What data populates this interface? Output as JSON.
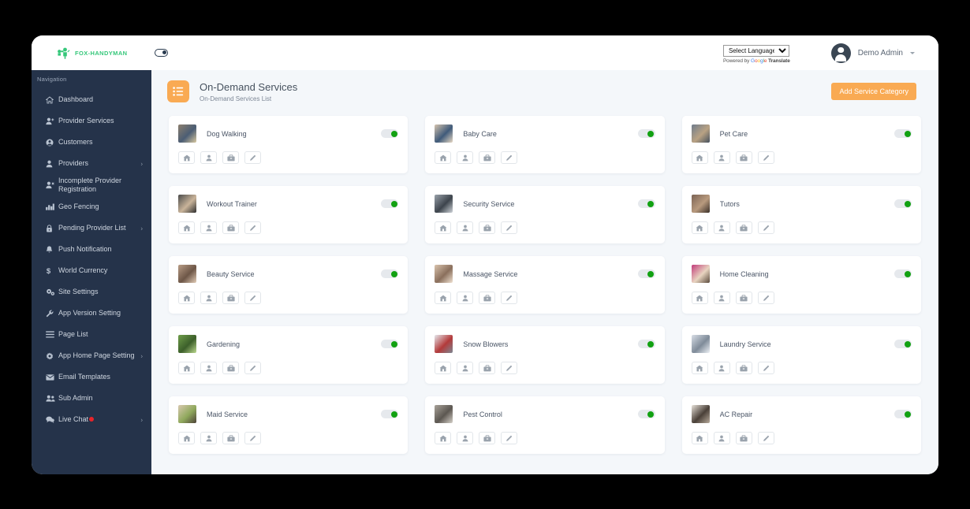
{
  "brand": {
    "name": "FOX-HANDYMAN",
    "logo_color": "#35c77a"
  },
  "topbar": {
    "language_selected": "Select Language",
    "language_options": [
      "Select Language"
    ],
    "powered_by": "Powered by",
    "google": "Google",
    "translate": "Translate",
    "user_name": "Demo Admin"
  },
  "sidebar": {
    "caption": "Navigation",
    "items": [
      {
        "label": "Dashboard",
        "icon": "home-icon",
        "chevron": false,
        "badge": false
      },
      {
        "label": "Provider Services",
        "icon": "user-plus-icon",
        "chevron": false,
        "badge": false
      },
      {
        "label": "Customers",
        "icon": "user-circle-icon",
        "chevron": false,
        "badge": false
      },
      {
        "label": "Providers",
        "icon": "user-icon",
        "chevron": true,
        "badge": false
      },
      {
        "label": "Incomplete Provider Registration",
        "icon": "user-times-icon",
        "chevron": false,
        "badge": false
      },
      {
        "label": "Geo Fencing",
        "icon": "map-icon",
        "chevron": false,
        "badge": false
      },
      {
        "label": "Pending Provider List",
        "icon": "lock-icon",
        "chevron": true,
        "badge": false
      },
      {
        "label": "Push Notification",
        "icon": "bell-icon",
        "chevron": false,
        "badge": false
      },
      {
        "label": "World Currency",
        "icon": "dollar-icon",
        "chevron": false,
        "badge": false
      },
      {
        "label": "Site Settings",
        "icon": "cogs-icon",
        "chevron": false,
        "badge": false
      },
      {
        "label": "App Version Setting",
        "icon": "wrench-icon",
        "chevron": false,
        "badge": false
      },
      {
        "label": "Page List",
        "icon": "list-icon",
        "chevron": false,
        "badge": false
      },
      {
        "label": "App Home Page Setting",
        "icon": "gear-icon",
        "chevron": true,
        "badge": false
      },
      {
        "label": "Email Templates",
        "icon": "envelope-icon",
        "chevron": false,
        "badge": false
      },
      {
        "label": "Sub Admin",
        "icon": "users-icon",
        "chevron": false,
        "badge": false
      },
      {
        "label": "Live Chat",
        "icon": "chat-icon",
        "chevron": true,
        "badge": true
      }
    ]
  },
  "page": {
    "title": "On-Demand Services",
    "subtitle": "On-Demand Services List",
    "icon": "list-icon",
    "add_button": "Add Service Category",
    "accent_color": "#f9aa53"
  },
  "card_actions": [
    {
      "name": "home-icon",
      "title": "Home"
    },
    {
      "name": "provider-icon",
      "title": "Provider"
    },
    {
      "name": "briefcase-icon",
      "title": "Services"
    },
    {
      "name": "edit-icon",
      "title": "Edit"
    }
  ],
  "services": [
    {
      "title": "Dog Walking",
      "enabled": true,
      "thumb": [
        "#8c7f6e",
        "#4b5d74",
        "#d9c9a0"
      ]
    },
    {
      "title": "Baby Care",
      "enabled": true,
      "thumb": [
        "#d6c4ae",
        "#3f5a7a",
        "#e8d9c4"
      ]
    },
    {
      "title": "Pet Care",
      "enabled": true,
      "thumb": [
        "#6f7c8c",
        "#b9a283",
        "#45505e"
      ]
    },
    {
      "title": "Workout Trainer",
      "enabled": true,
      "thumb": [
        "#4a4a4a",
        "#c9b49a",
        "#2e2e2e"
      ]
    },
    {
      "title": "Security Service",
      "enabled": true,
      "thumb": [
        "#9aa2ab",
        "#3d444c",
        "#cfd4d9"
      ]
    },
    {
      "title": "Tutors",
      "enabled": true,
      "thumb": [
        "#7a6253",
        "#b89a7e",
        "#3a2f28"
      ]
    },
    {
      "title": "Beauty Service",
      "enabled": true,
      "thumb": [
        "#b99d86",
        "#6d5647",
        "#e3cdb8"
      ]
    },
    {
      "title": "Massage Service",
      "enabled": true,
      "thumb": [
        "#d9c3ad",
        "#8a6f5c",
        "#f0e2d2"
      ]
    },
    {
      "title": "Home Cleaning",
      "enabled": true,
      "thumb": [
        "#c23b7a",
        "#e8d4c0",
        "#5a4a3c"
      ]
    },
    {
      "title": "Gardening",
      "enabled": true,
      "thumb": [
        "#6f9e4a",
        "#3c5f2a",
        "#bcd98f"
      ]
    },
    {
      "title": "Snow Blowers",
      "enabled": true,
      "thumb": [
        "#e5e9ee",
        "#b33a3a",
        "#7d8893"
      ]
    },
    {
      "title": "Laundry Service",
      "enabled": true,
      "thumb": [
        "#d8dee6",
        "#7f8b99",
        "#eef2f6"
      ]
    },
    {
      "title": "Maid Service",
      "enabled": true,
      "thumb": [
        "#d9c9b0",
        "#8fa85c",
        "#4d4238"
      ]
    },
    {
      "title": "Pest Control",
      "enabled": true,
      "thumb": [
        "#a9a39a",
        "#5c5751",
        "#d6d1c9"
      ]
    },
    {
      "title": "AC Repair",
      "enabled": true,
      "thumb": [
        "#e8e2da",
        "#4a4038",
        "#b7aa9b"
      ]
    }
  ]
}
